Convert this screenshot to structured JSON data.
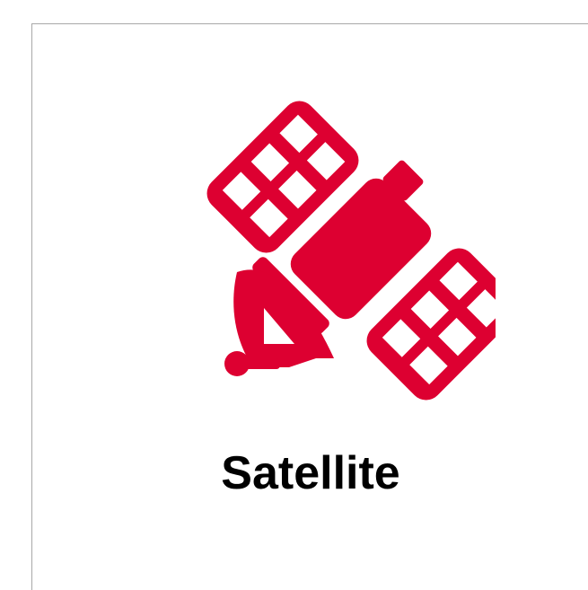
{
  "card": {
    "title": "Satellite",
    "icon_name": "satellite-icon",
    "icon_color": "#dd0031",
    "text_color": "#000000",
    "border_color": "#a8a8a8"
  }
}
